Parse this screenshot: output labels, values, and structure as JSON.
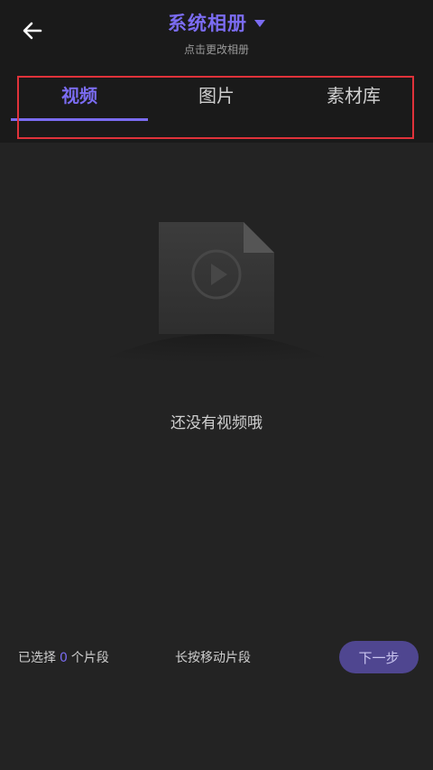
{
  "header": {
    "title": "系统相册",
    "subtitle": "点击更改相册"
  },
  "tabs": [
    {
      "label": "视频",
      "active": true
    },
    {
      "label": "图片",
      "active": false
    },
    {
      "label": "素材库",
      "active": false
    }
  ],
  "empty_state": {
    "message": "还没有视频哦"
  },
  "footer": {
    "selected_prefix": "已选择",
    "selected_count": "0",
    "selected_suffix": "个片段",
    "hint": "长按移动片段",
    "next_label": "下一步"
  },
  "colors": {
    "accent": "#7b6cf2",
    "background": "#232323",
    "header_background": "#1a1a1a",
    "highlight_border": "#e0323a",
    "next_button": "#4f4690"
  },
  "icons": {
    "back": "arrow-left-icon",
    "dropdown": "caret-down-icon",
    "empty": "video-file-icon"
  }
}
